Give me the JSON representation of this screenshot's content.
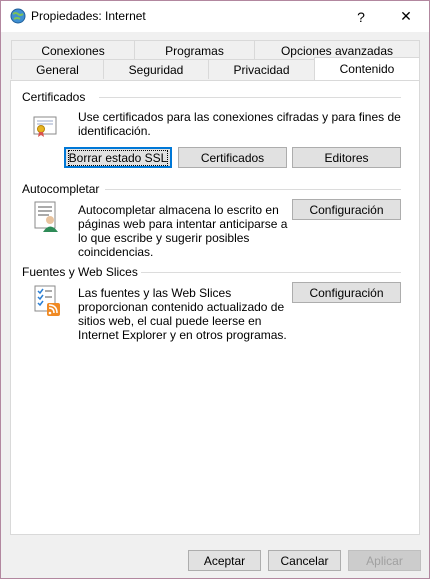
{
  "window": {
    "title": "Propiedades: Internet",
    "help_label": "?",
    "close_label": "✕"
  },
  "tabs": {
    "row1": [
      "Conexiones",
      "Programas",
      "Opciones avanzadas"
    ],
    "row2": [
      "General",
      "Seguridad",
      "Privacidad",
      "Contenido"
    ],
    "active": "Contenido"
  },
  "certificados": {
    "title": "Certificados",
    "description_line1": "Use certificados para las conexiones cifradas y para fines de",
    "description_line2": "identificación.",
    "buttons": [
      "Borrar estado SSL",
      "Certificados",
      "Editores"
    ]
  },
  "autocompletar": {
    "title": "Autocompletar",
    "lines": [
      "Autocompletar almacena lo escrito en",
      "páginas web para intentar anticiparse a",
      "lo que escribe y sugerir posibles",
      "coincidencias."
    ],
    "button": "Configuración"
  },
  "fuentes": {
    "title": "Fuentes y Web Slices",
    "lines": [
      "Las fuentes y las Web Slices",
      "proporcionan contenido actualizado de",
      "sitios web, el cual puede leerse en",
      "Internet Explorer y en otros programas."
    ],
    "button": "Configuración"
  },
  "footer": {
    "accept": "Aceptar",
    "cancel": "Cancelar",
    "apply": "Aplicar"
  }
}
